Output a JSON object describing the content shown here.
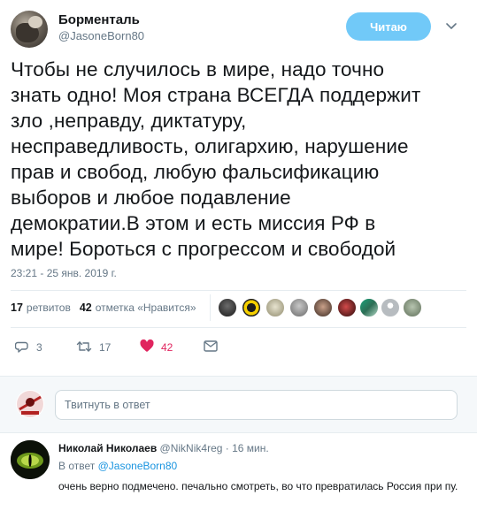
{
  "author": {
    "name": "Борменталь",
    "handle": "@JasoneBorn80"
  },
  "follow_button": {
    "label": "Читаю",
    "color": "#71c9f8"
  },
  "tweet": {
    "text": "Чтобы не случилось в мире, надо точно\nзнать одно! Моя страна ВСЕГДА поддержит\nзло ,неправду, диктатуру,\nнесправедливость, олигархию, нарушение\nправ и свобод, любую фальсификацию\nвыборов и любое подавление\nдемократии.В этом и есть миссия РФ в\nмире! Бороться с прогрессом и свободой",
    "timestamp": "23:21 - 25 янв. 2019 г."
  },
  "stats": {
    "retweets_count": "17",
    "retweets_label": "ретвитов",
    "likes_count": "42",
    "likes_label": "отметка «Нравится»"
  },
  "liker_avatars": [
    "liker-1",
    "liker-2",
    "liker-3",
    "liker-4",
    "liker-5",
    "liker-6",
    "liker-7",
    "liker-8",
    "liker-9"
  ],
  "actions": {
    "reply_count": "3",
    "retweet_count": "17",
    "like_count": "42"
  },
  "reply_box": {
    "placeholder": "Твитнуть в ответ"
  },
  "reply": {
    "name": "Николай Николаев",
    "handle": "@NikNik4reg",
    "separator": "·",
    "time": "16 мин.",
    "in_reply_prefix": "В ответ",
    "in_reply_handle": "@JasoneBorn80",
    "text": "очень верно подмечено. печально смотреть, во что превратилась  Россия при пу."
  },
  "colors": {
    "accent": "#1b95e0",
    "like": "#e0245e",
    "muted": "#657786",
    "text": "#14171a"
  }
}
